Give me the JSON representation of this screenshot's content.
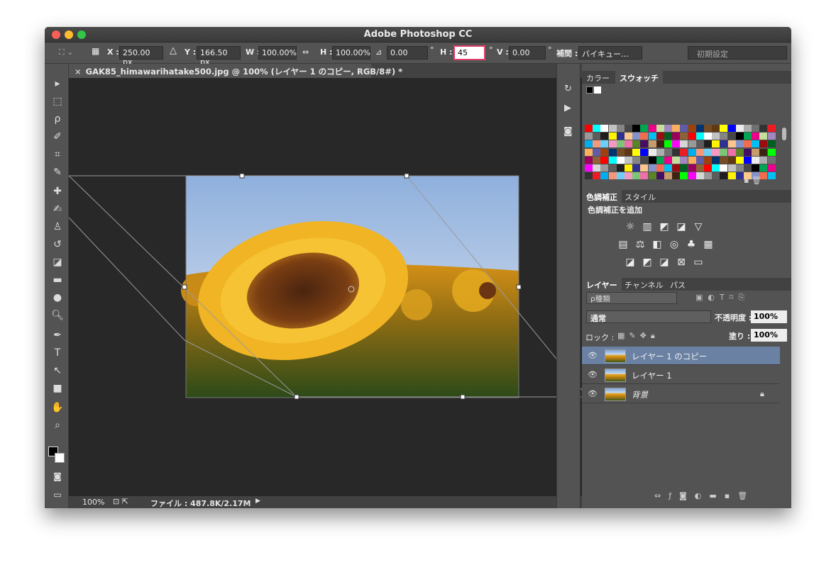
{
  "app": {
    "title": "Adobe Photoshop CC"
  },
  "options_bar": {
    "x_label": "X :",
    "x_value": "250.00 px",
    "delta_glyph": "△",
    "y_label": "Y :",
    "y_value": "166.50 px",
    "w_label": "W :",
    "w_value": "100.00%",
    "h_label": "H :",
    "h_value": "100.00%",
    "rotate_value": "0.00",
    "degree": "°",
    "hskew_label": "H :",
    "hskew_value": "45",
    "vskew_label": "V :",
    "vskew_value": "0.00",
    "interp_label": "補間 :",
    "interp_value": "バイキュー…",
    "preset_value": "初期設定"
  },
  "document": {
    "tab_title": "GAK85_himawarihatake500.jpg @ 100% (レイヤー 1 のコピー, RGB/8#) *",
    "close_glyph": "×"
  },
  "statusbar": {
    "zoom": "100%",
    "file_info": "ファイル : 487.8K/2.17M"
  },
  "panels": {
    "color_tabs": [
      "カラー",
      "スウォッチ"
    ],
    "adjust_tabs": [
      "色調補正",
      "スタイル"
    ],
    "adjust_heading": "色調補正を追加",
    "layers_tabs": [
      "レイヤー",
      "チャンネル",
      "パス"
    ],
    "filter_label": "ρ種類",
    "blend_mode": "通常",
    "opacity_label": "不透明度 :",
    "opacity_value": "100%",
    "lock_label": "ロック :",
    "fill_label": "塗り :",
    "fill_value": "100%",
    "layers": [
      {
        "name": "レイヤー 1 のコピー",
        "selected": true
      },
      {
        "name": "レイヤー 1",
        "selected": false
      },
      {
        "name": "背景",
        "selected": false,
        "locked": true
      }
    ]
  },
  "colors": {
    "accent_highlight": "#e0406a",
    "selected_layer": "#6a81a3",
    "window_bg": "#535353",
    "canvas_bg": "#282828"
  }
}
